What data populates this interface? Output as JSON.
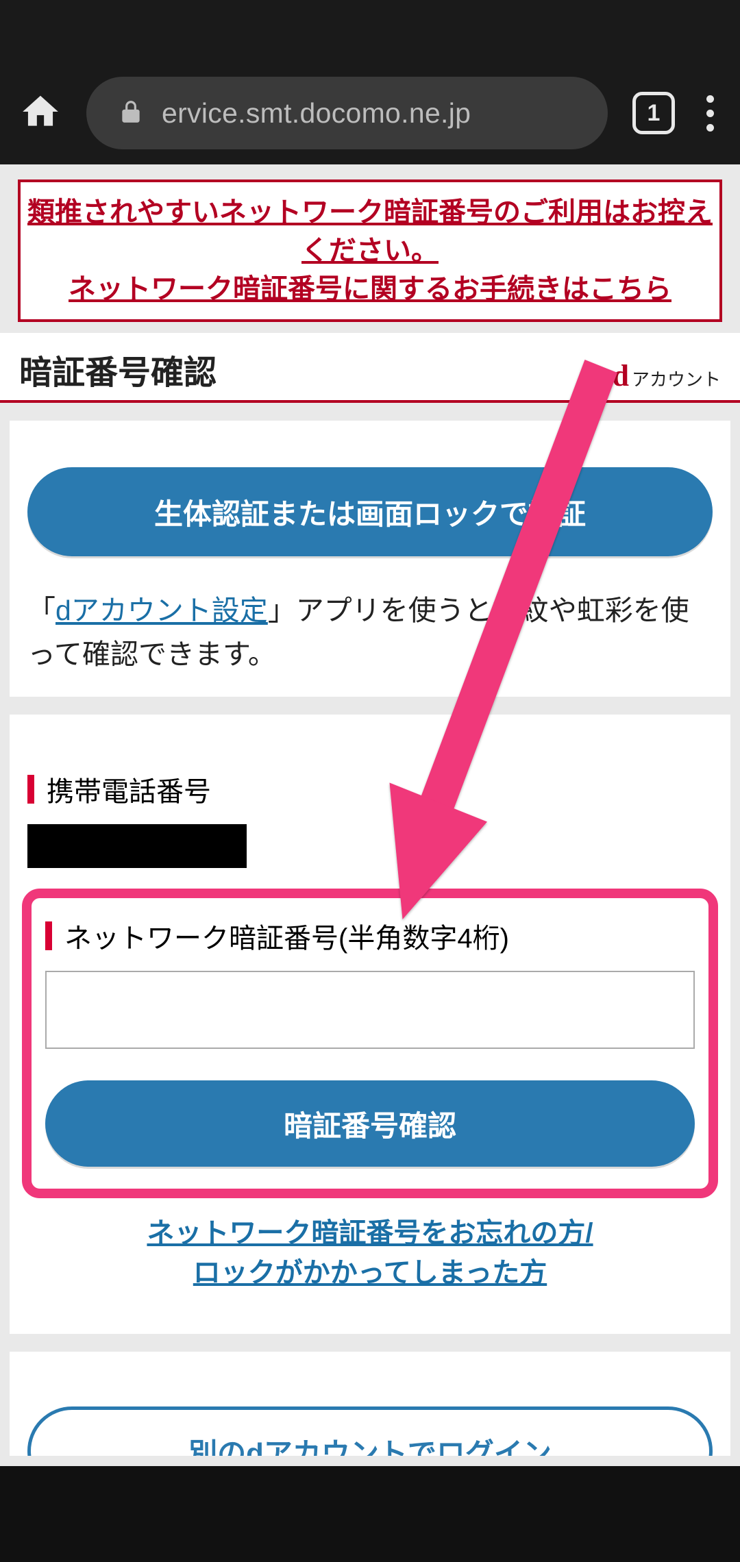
{
  "browser": {
    "url": "ervice.smt.docomo.ne.jp",
    "tab_count": "1"
  },
  "warning": {
    "line1": "類推されやすいネットワーク暗証番号のご利用はお控えください。",
    "line2": "ネットワーク暗証番号に関するお手続きはこちら"
  },
  "header": {
    "title": "暗証番号確認",
    "logo_text": "アカウント"
  },
  "biometric": {
    "button": "生体認証または画面ロックで認証",
    "help_prefix": "「",
    "help_link": "dアカウント設定",
    "help_suffix": "」アプリを使うと指紋や虹彩を使って確認できます。"
  },
  "phone": {
    "label": "携帯電話番号"
  },
  "pin": {
    "label": "ネットワーク暗証番号(半角数字4桁)",
    "value": "",
    "confirm_button": "暗証番号確認"
  },
  "forgot": {
    "line1": "ネットワーク暗証番号をお忘れの方/",
    "line2": "ロックがかかってしまった方"
  },
  "alt_login": {
    "button": "別のdアカウントでログイン"
  }
}
